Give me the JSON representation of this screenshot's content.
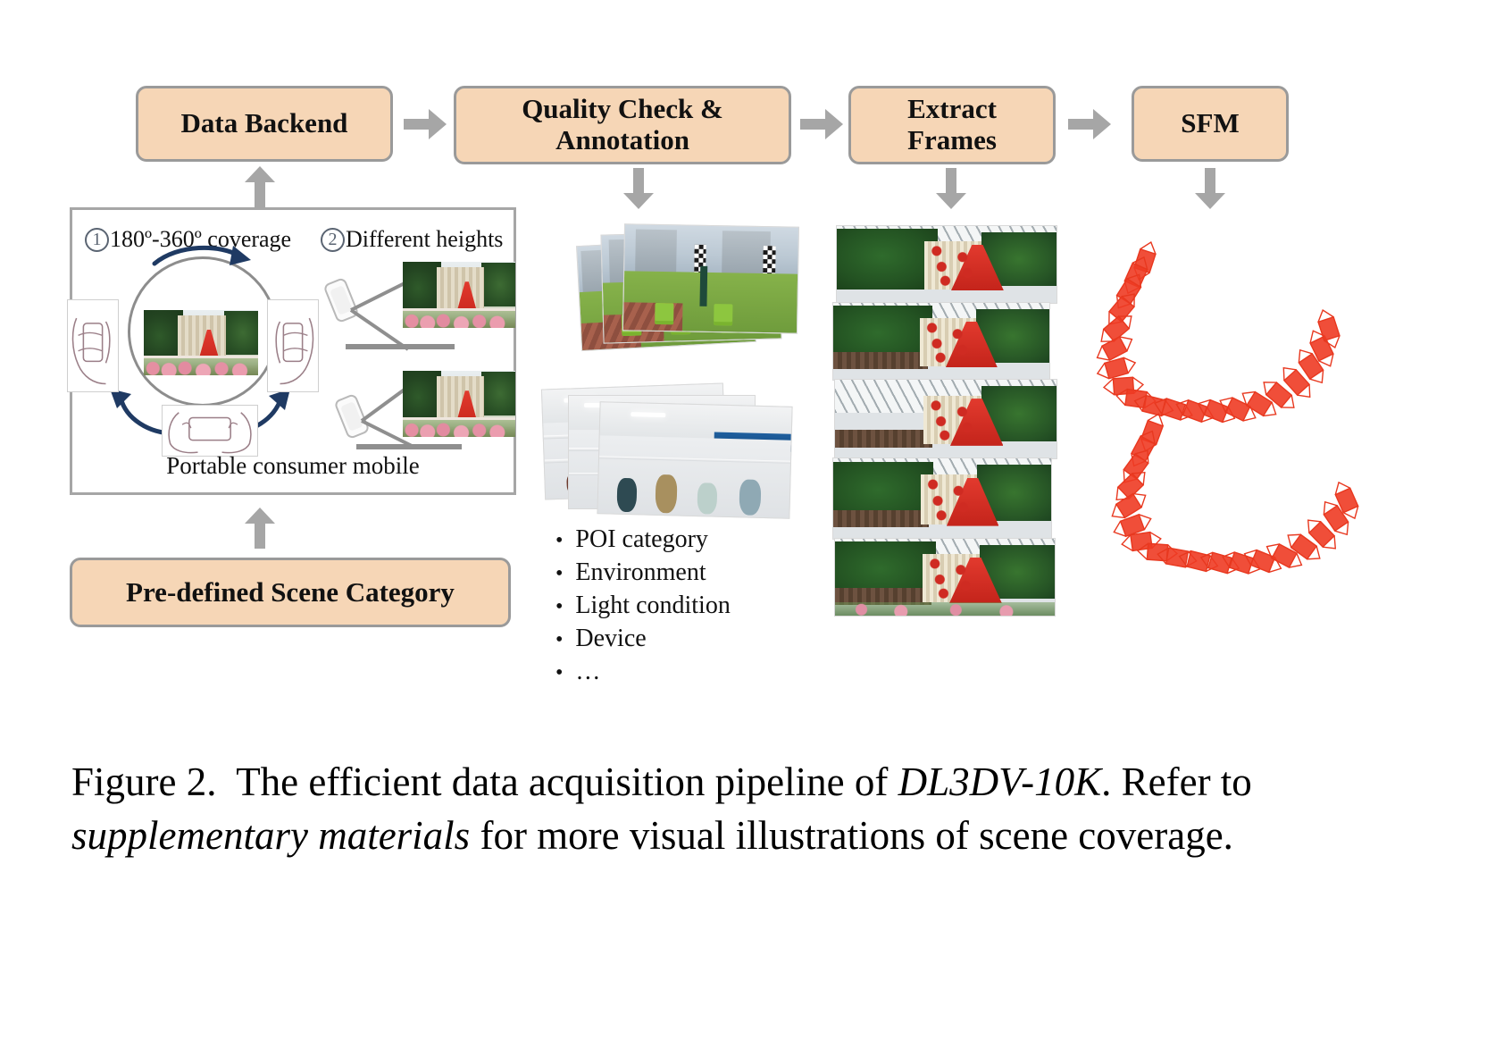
{
  "figure": {
    "caption_prefix": "Figure 2.",
    "caption_part1": "The efficient data acquisition pipeline of ",
    "caption_italic1": "DL3DV-10K",
    "caption_part2": ". Refer to ",
    "caption_italic2": "supplementary materials",
    "caption_part3": " for more visual illustrations of scene coverage."
  },
  "pipeline": {
    "boxes": [
      {
        "id": "data-backend",
        "label": "Data Backend"
      },
      {
        "id": "quality-check",
        "label_line1": "Quality Check &",
        "label_line2": "Annotation"
      },
      {
        "id": "extract-frames",
        "label_line1": "Extract",
        "label_line2": "Frames"
      },
      {
        "id": "sfm",
        "label": "SFM"
      }
    ],
    "input_box": {
      "id": "pre-defined-scene-category",
      "label": "Pre-defined Scene Category"
    }
  },
  "capture_panel": {
    "item1": {
      "marker": "1",
      "label": "180º-360º coverage"
    },
    "item2": {
      "marker": "2",
      "label": "Different heights"
    },
    "footer": "Portable consumer mobile"
  },
  "annotation_list": {
    "items": [
      "POI category",
      "Environment",
      "Light condition",
      "Device",
      "…"
    ],
    "bullet_glyph": "•"
  },
  "colors": {
    "box_fill": "#f6d6b6",
    "box_border": "#9a9a9a",
    "arrow": "#a6a6a6",
    "camera_frustum": "#ee3b24",
    "marker_circle": "#5a6472",
    "orbit_arrow": "#1f3a63"
  }
}
